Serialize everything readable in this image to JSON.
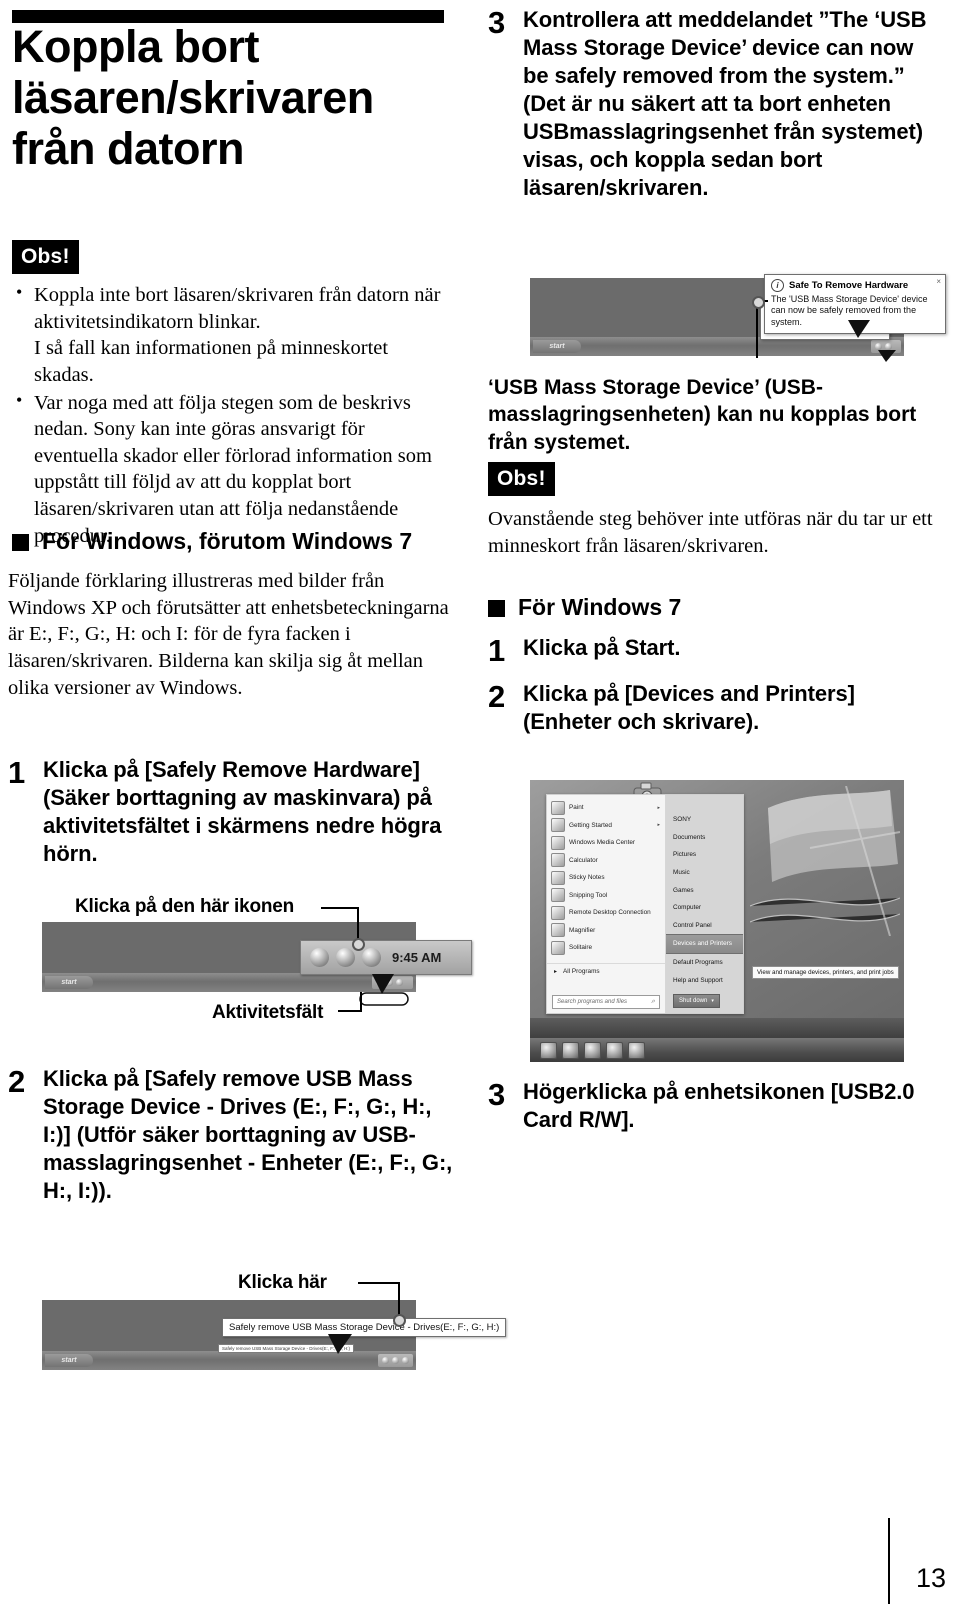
{
  "page": {
    "number": "13"
  },
  "left": {
    "chapter_title": "Koppla bort läsaren/skrivaren från datorn",
    "note_badge": "Obs!",
    "notes": [
      "Koppla inte bort läsaren/skrivaren från datorn när aktivitetsindikatorn blinkar.\nI så fall kan informationen på minneskortet skadas.",
      "Var noga med att följa stegen som de beskrivs nedan. Sony kan inte göras ansvarigt för eventuella skador eller förlorad information som uppstått till följd av att du kopplat bort läsaren/skrivaren utan att följa nedanstående procedur."
    ],
    "section_heading": "För Windows, förutom Windows 7",
    "intro_paragraph": "Följande förklaring illustreras med bilder från Windows XP och förutsätter att enhetsbeteckningarna är E:, F:, G:, H: och I: för de fyra facken i läsaren/skrivaren. Bilderna kan skilja sig åt mellan olika versioner av Windows.",
    "step1": {
      "number": "1",
      "text": "Klicka på [Safely Remove Hardware] (Säker borttagning av maskinvara) på aktivitetsfältet i skärmens nedre högra hörn."
    },
    "fig1": {
      "callout_top": "Klicka på den här ikonen",
      "callout_bottom": "Aktivitetsfält",
      "start_label": "start",
      "clock": "9:45 AM"
    },
    "step2": {
      "number": "2",
      "text": "Klicka på [Safely remove USB Mass Storage Device - Drives (E:, F:, G:, H:, I:)] (Utför säker borttagning av USB-masslagringsenhet - Enheter (E:, F:, G:, H:, I:))."
    },
    "fig2": {
      "callout_top": "Klicka här",
      "tooltip": "Safely remove USB Mass Storage Device - Drives(E:, F:, G:, H:)",
      "tooltip_small": "Safely remove USB Mass Storage Device - Drives(E:, F:, G:, H:)",
      "start_label": "start"
    }
  },
  "right": {
    "step3": {
      "number": "3",
      "text": "Kontrollera att meddelandet ”The ‘USB Mass Storage Device’ device can now be safely removed from the system.” (Det är nu säkert att ta bort enheten USBmasslagringsenhet från systemet) visas, och koppla sedan bort läsaren/skrivaren."
    },
    "fig3": {
      "balloon_title": "Safe To Remove Hardware",
      "balloon_body": "The 'USB Mass Storage Device' device can now be safely removed from the system.",
      "balloon_close": "×",
      "small_title": "Safe To Remove Hardware",
      "small_body": "The 'USB Mass Storage Device' device can now be safely removed from the system.",
      "start_label": "start",
      "info_icon": "info-icon"
    },
    "caption": "‘USB Mass Storage Device’ (USB-masslagringsenheten) kan nu kopplas bort från systemet.",
    "note_badge": "Obs!",
    "note_text": "Ovanstående steg behöver inte utföras när du tar ur ett minneskort från läsaren/skrivaren.",
    "section_heading": "För Windows 7",
    "step_w7_1": {
      "number": "1",
      "text": "Klicka på Start."
    },
    "step_w7_2": {
      "number": "2",
      "text": "Klicka på [Devices and Printers] (Enheter och skrivare)."
    },
    "startmenu": {
      "left_items": [
        {
          "label": "Paint",
          "submenu": "▸"
        },
        {
          "label": "Getting Started",
          "submenu": "▸"
        },
        {
          "label": "Windows Media Center",
          "submenu": ""
        },
        {
          "label": "Calculator",
          "submenu": ""
        },
        {
          "label": "Sticky Notes",
          "submenu": ""
        },
        {
          "label": "Snipping Tool",
          "submenu": ""
        },
        {
          "label": "Remote Desktop Connection",
          "submenu": ""
        },
        {
          "label": "Magnifier",
          "submenu": ""
        },
        {
          "label": "Solitaire",
          "submenu": ""
        }
      ],
      "all_programs": "All Programs",
      "search_placeholder": "Search programs and files",
      "right_items": [
        "SONY",
        "Documents",
        "Pictures",
        "Music",
        "Games",
        "Computer",
        "Control Panel",
        "Devices and Printers",
        "Default Programs",
        "Help and Support"
      ],
      "highlighted_item": "Devices and Printers",
      "tooltip": "View and manage devices, printers, and print jobs",
      "shutdown": "Shut down"
    },
    "step_w7_3": {
      "number": "3",
      "text": "Högerklicka på enhetsikonen [USB2.0 Card R/W]."
    }
  }
}
